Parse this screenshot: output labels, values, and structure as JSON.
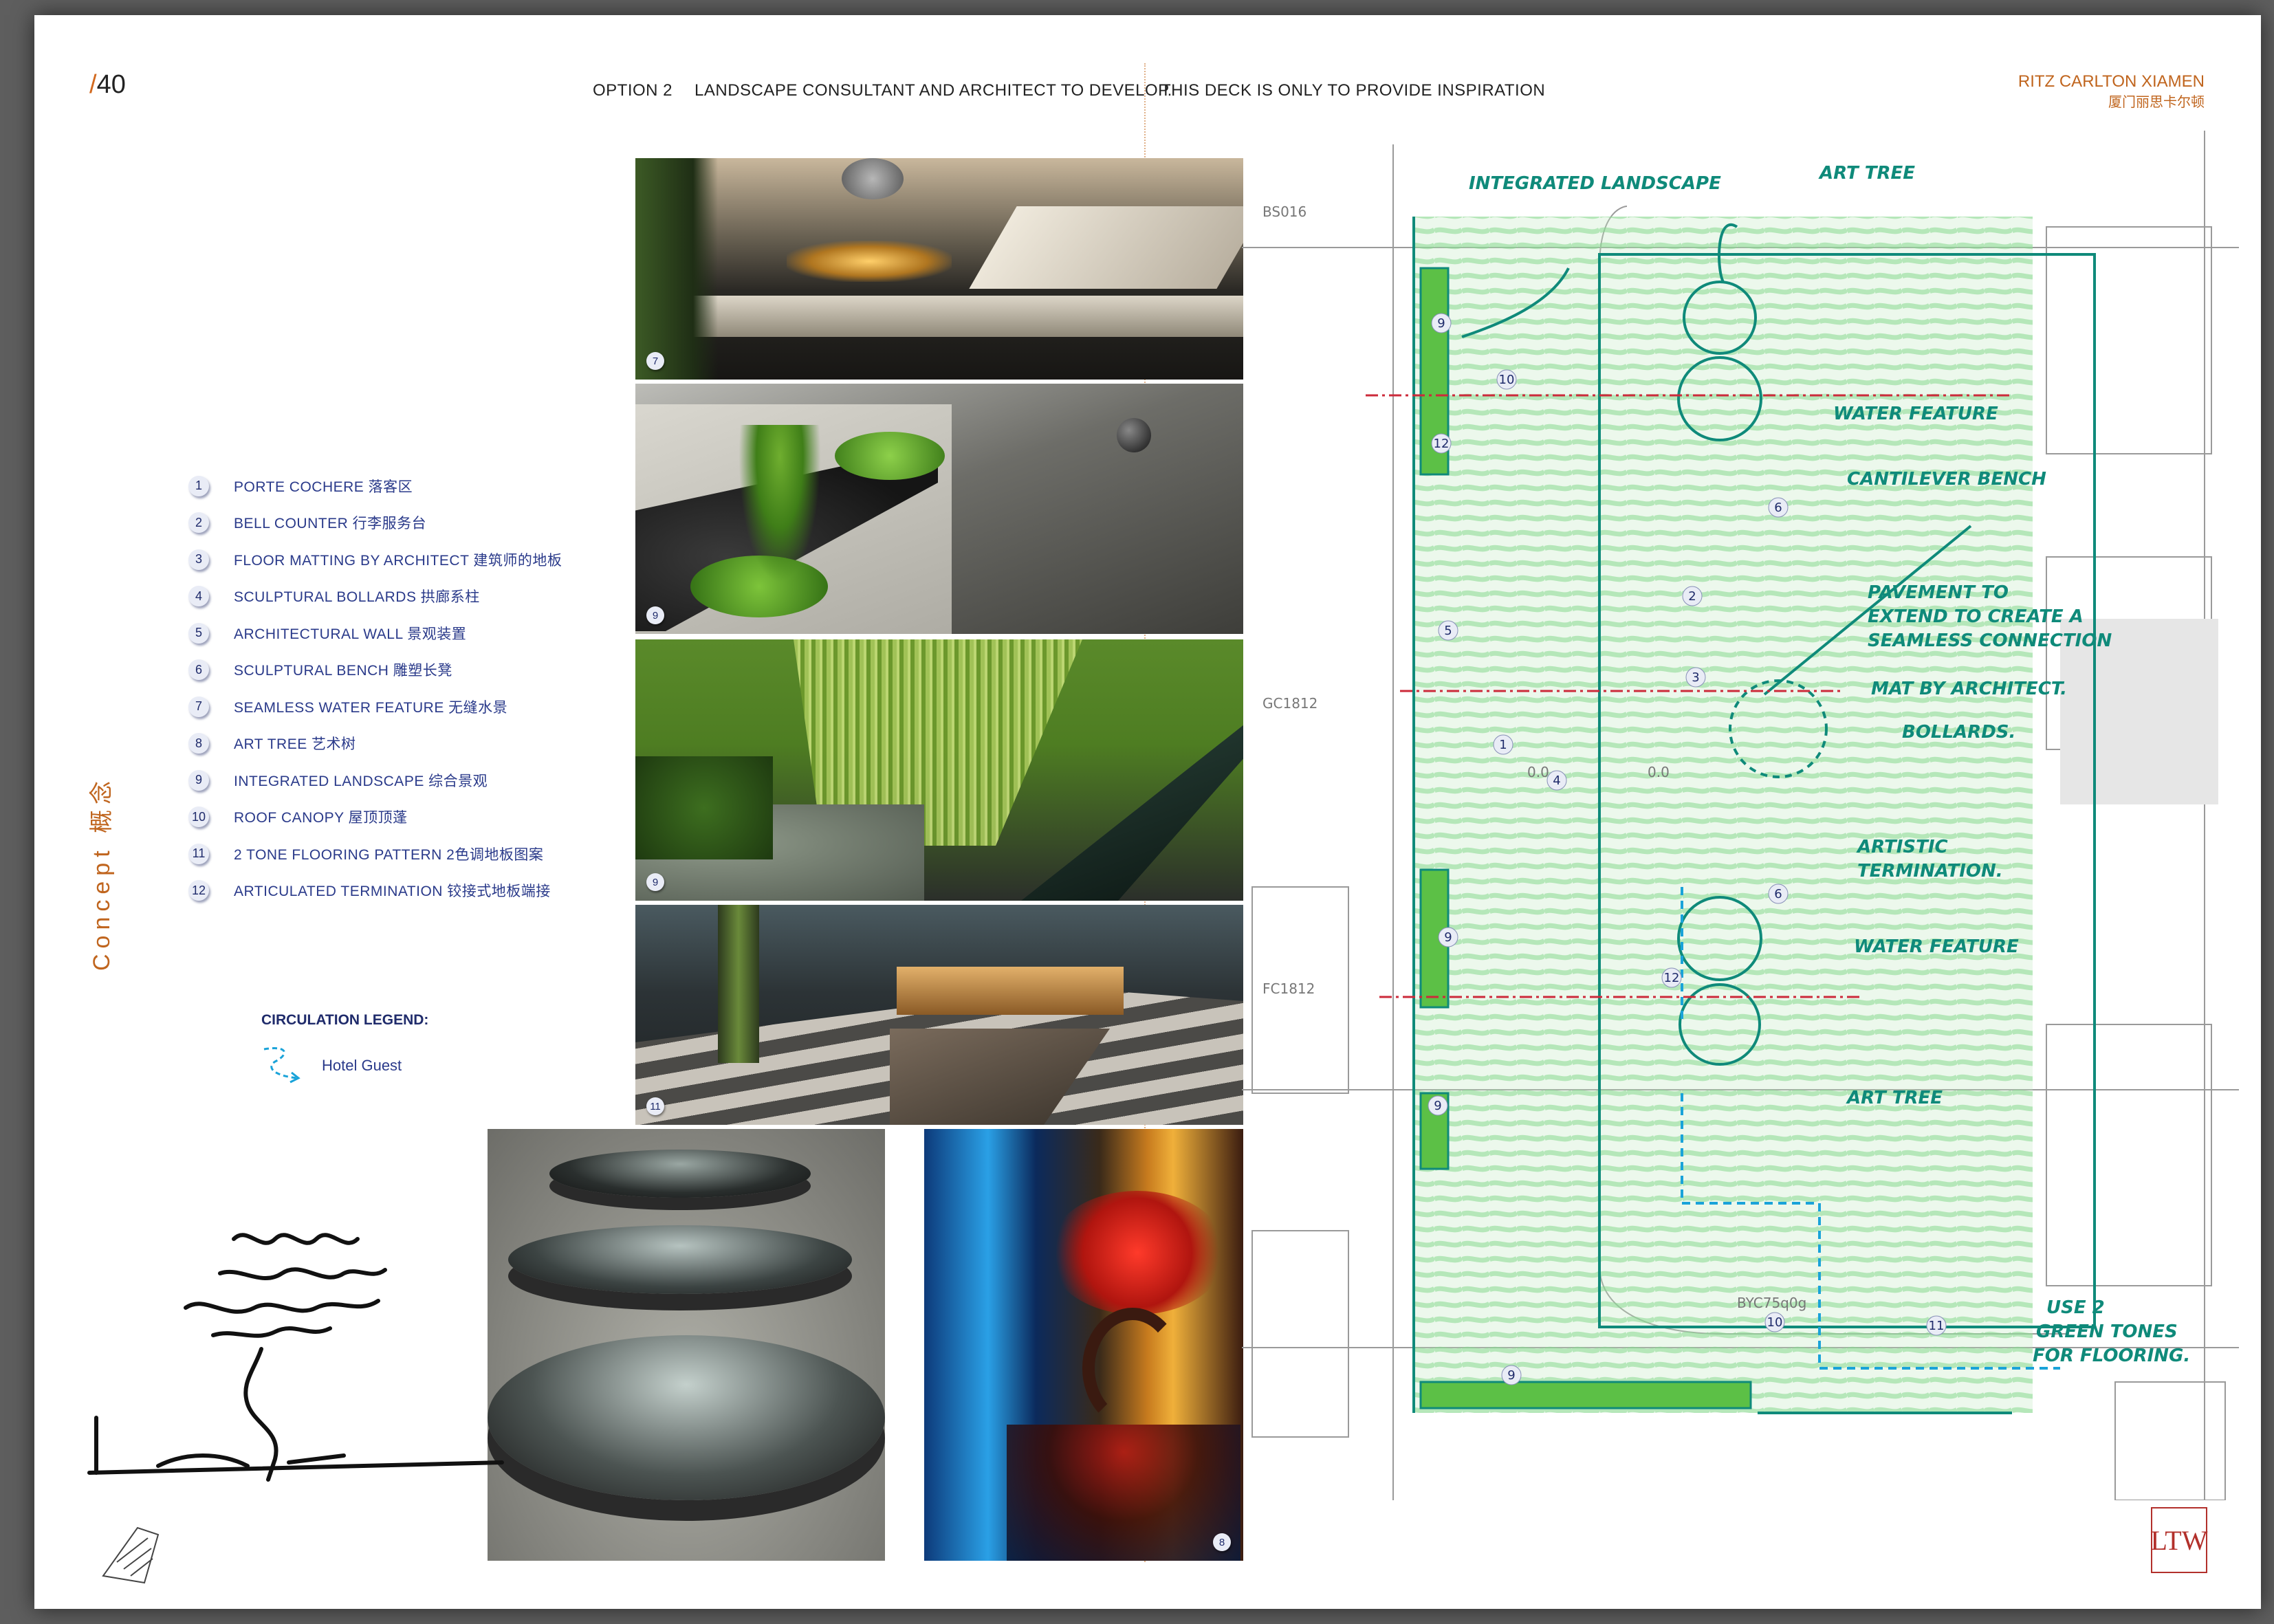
{
  "page_number": "40",
  "header": {
    "option": "OPTION 2",
    "development_note": "LANDSCAPE  CONSULTANT AND ARCHITECT TO DEVELOP.",
    "inspiration_note": "THIS DECK IS ONLY TO PROVIDE INSPIRATION"
  },
  "brand": {
    "name": "RITZ CARLTON XIAMEN",
    "name_cn": "厦门丽思卡尔顿"
  },
  "section_label": "Concept  概念",
  "legend": [
    {
      "num": "1",
      "label": "PORTE COCHERE 落客区"
    },
    {
      "num": "2",
      "label": "BELL COUNTER 行李服务台"
    },
    {
      "num": "3",
      "label": "FLOOR MATTING BY ARCHITECT 建筑师的地板"
    },
    {
      "num": "4",
      "label": "SCULPTURAL BOLLARDS 拱廊系柱"
    },
    {
      "num": "5",
      "label": "ARCHITECTURAL WALL 景观装置"
    },
    {
      "num": "6",
      "label": "SCULPTURAL BENCH 雕塑长凳"
    },
    {
      "num": "7",
      "label": "SEAMLESS WATER FEATURE 无缝水景"
    },
    {
      "num": "8",
      "label": "ART TREE 艺术树"
    },
    {
      "num": "9",
      "label": "INTEGRATED LANDSCAPE 综合景观"
    },
    {
      "num": "10",
      "label": "ROOF CANOPY 屋顶顶蓬"
    },
    {
      "num": "11",
      "label": "2 TONE FLOORING PATTERN 2色调地板图案"
    },
    {
      "num": "12",
      "label": "ARTICULATED TERMINATION 铰接式地板端接"
    }
  ],
  "circulation": {
    "title": "CIRCULATION LEGEND:",
    "item": "Hotel Guest",
    "color": "#1aa3d9"
  },
  "photos": [
    {
      "tag": "7"
    },
    {
      "tag": "9"
    },
    {
      "tag": "9"
    },
    {
      "tag": "11"
    },
    {
      "tag": "8"
    }
  ],
  "plan_annotations": {
    "integrated_landscape": "INTEGRATED LANDSCAPE",
    "art_tree_top": "ART TREE",
    "water_feature_top": "WATER FEATURE",
    "cantilever_bench": "CANTILEVER BENCH",
    "pavement_1": "PAVEMENT TO",
    "pavement_2": "EXTEND TO CREATE A",
    "pavement_3": "SEAMLESS CONNECTION",
    "mat": "MAT BY ARCHITECT.",
    "bollards": "BOLLARDS.",
    "artistic_1": "ARTISTIC",
    "artistic_2": "TERMINATION.",
    "water_feature_bottom": "WATER FEATURE",
    "art_tree_bottom": "ART TREE",
    "use_1": "USE 2",
    "use_2": "GREEN TONES",
    "use_3": "FOR FLOORING.",
    "code_1": "BS016",
    "code_2": "GC1812",
    "code_3": "FC1812",
    "code_4": "BYC75q0g",
    "elev_1": "0.0",
    "elev_2": "0.0",
    "markers": [
      "9",
      "10",
      "12",
      "6",
      "2",
      "5",
      "3",
      "1",
      "4",
      "6",
      "9",
      "12",
      "9",
      "10",
      "11",
      "9"
    ]
  },
  "logo": "LTW",
  "colors": {
    "accent": "#c0651e",
    "navy": "#1f2b6b",
    "sketch": "#0f8a7a",
    "green": "#9ed89a"
  }
}
